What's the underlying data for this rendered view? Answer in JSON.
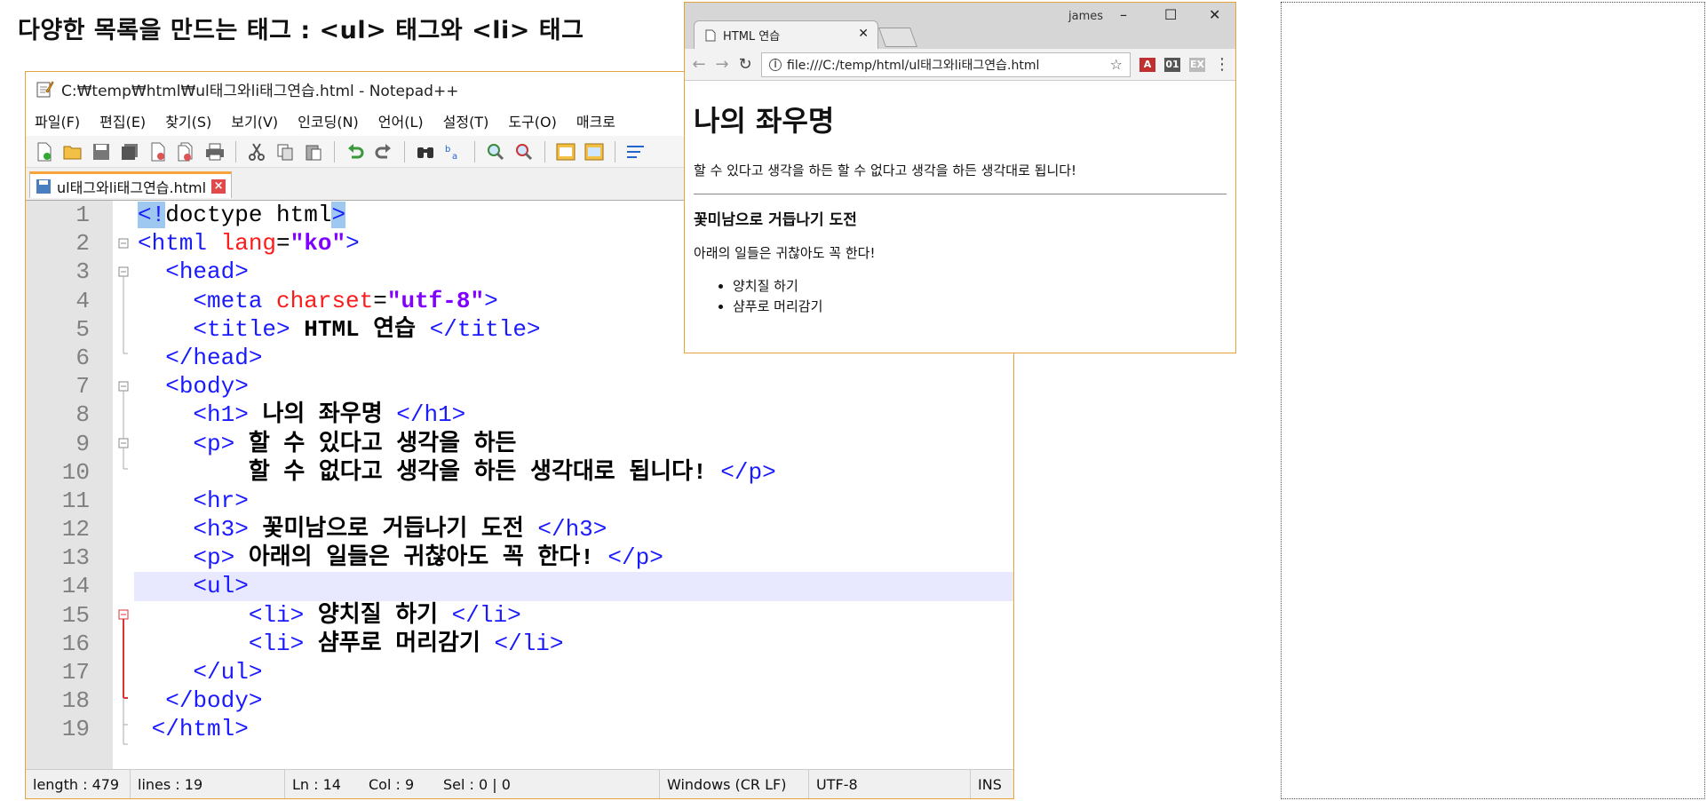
{
  "slide_title": "다양한 목록을 만드는 태그 : <ul> 태그와 <li> 태그",
  "notepad": {
    "title": "C:₩temp₩html₩ul태그와li태그연습.html - Notepad++",
    "menu": [
      "파일(F)",
      "편집(E)",
      "찾기(S)",
      "보기(V)",
      "인코딩(N)",
      "언어(L)",
      "설정(T)",
      "도구(O)",
      "매크로"
    ],
    "tab_label": "ul태그와li태그연습.html",
    "line_numbers": [
      "1",
      "2",
      "3",
      "4",
      "5",
      "6",
      "7",
      "8",
      "9",
      "10",
      "11",
      "12",
      "13",
      "14",
      "15",
      "16",
      "17",
      "18",
      "19"
    ],
    "code": {
      "l1_a": "<!",
      "l1_b": "doctype html",
      "l1_c": ">",
      "l2_open": "<html ",
      "l2_attr": "lang",
      "l2_eq": "=",
      "l2_val": "\"ko\"",
      "l2_close": ">",
      "l3": "<head>",
      "l4_open": "<meta ",
      "l4_attr": "charset",
      "l4_eq": "=",
      "l4_val": "\"utf-8\"",
      "l4_close": ">",
      "l5_open": "<title>",
      "l5_text": " HTML 연습 ",
      "l5_close": "</title>",
      "l6": "</head>",
      "l7": "<body>",
      "l8_open": "<h1>",
      "l8_text": " 나의 좌우명 ",
      "l8_close": "</h1>",
      "l9_open": "<p>",
      "l9_text": " 할 수 있다고 생각을 하든",
      "l10_text": "할 수 없다고 생각을 하든 생각대로 됩니다! ",
      "l10_close": "</p>",
      "l11": "<hr>",
      "l12_open": "<h3>",
      "l12_text": " 꽃미남으로 거듭나기 도전 ",
      "l12_close": "</h3>",
      "l13_open": "<p>",
      "l13_text": " 아래의 일들은 귀찮아도 꼭 한다! ",
      "l13_close": "</p>",
      "l14": "<ul>",
      "l15_open": "<li>",
      "l15_text": " 양치질 하기 ",
      "l15_close": "</li>",
      "l16_open": "<li>",
      "l16_text": " 샴푸로 머리감기 ",
      "l16_close": "</li>",
      "l17": "</ul>",
      "l18": "</body>",
      "l19": "</html>"
    },
    "status": {
      "length": "length : 479",
      "lines": "lines : 19",
      "ln": "Ln : 14",
      "col": "Col : 9",
      "sel": "Sel : 0 | 0",
      "eol": "Windows (CR LF)",
      "encoding": "UTF-8",
      "mode": "INS"
    }
  },
  "browser": {
    "tab_title": "HTML 연습",
    "user": "james",
    "url": "file:///C:/temp/html/ul태그와li태그연습.html",
    "ext1": "01",
    "ext2": "EX",
    "page": {
      "h1": "나의 좌우명",
      "p1": "할 수 있다고 생각을 하든 할 수 없다고 생각을 하든 생각대로 됩니다!",
      "h3": "꽃미남으로 거듭나기 도전",
      "p2": "아래의 일들은 귀찮아도 꼭 한다!",
      "list": [
        "양치질 하기",
        "샴푸로 머리감기"
      ]
    }
  }
}
